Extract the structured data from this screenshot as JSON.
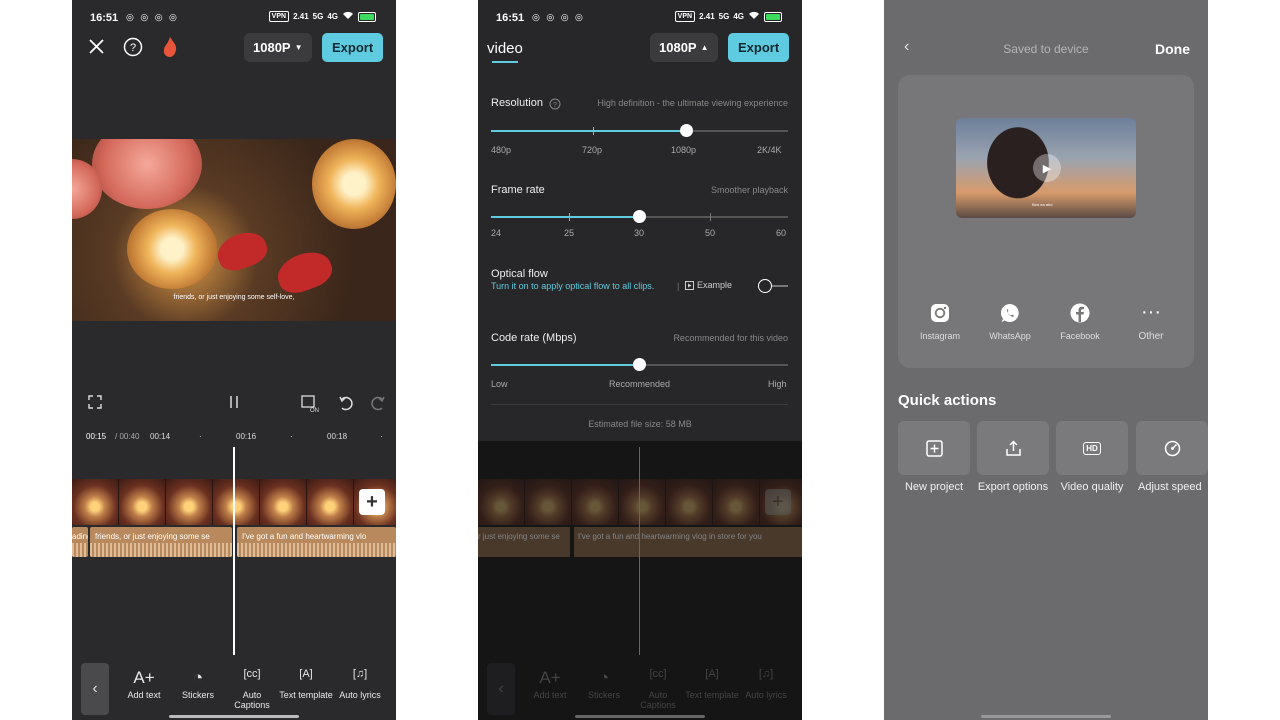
{
  "status": {
    "time": "16:51",
    "notif_icons": "◎ ◎ ◎ ◎",
    "vpn": "VPN",
    "net1": "2.41",
    "net2": "5G",
    "net3": "4G"
  },
  "editor": {
    "resolution_btn": "1080P",
    "export_label": "Export",
    "caption": "friends, or just enjoying some self-love,",
    "timecode_current": "00:15",
    "timecode_total": "/ 00:40",
    "ruler_marks": [
      "00:14",
      "00:16",
      "00:18"
    ],
    "tracks": {
      "left": "ading",
      "middle": "friends, or just enjoying some se",
      "right": "I've got a fun and heartwarming vlo"
    },
    "tools": [
      {
        "label": "Add text",
        "icon": "A+"
      },
      {
        "label": "Stickers",
        "icon": "◔"
      },
      {
        "label": "Auto Captions",
        "icon": "[cc]"
      },
      {
        "label": "Text template",
        "icon": "[A]"
      },
      {
        "label": "Auto lyrics",
        "icon": "[♫]"
      }
    ],
    "add_clip_symbol": "+"
  },
  "export_settings": {
    "tab_title": "video",
    "resolution_btn": "1080P",
    "export_label": "Export",
    "resolution": {
      "label": "Resolution",
      "hint": "High definition - the ultimate viewing experience",
      "options": [
        "480p",
        "720p",
        "1080p",
        "2K/4K"
      ],
      "selected_index": 2
    },
    "frame_rate": {
      "label": "Frame rate",
      "hint": "Smoother playback",
      "options": [
        "24",
        "25",
        "30",
        "50",
        "60"
      ],
      "selected_index": 2
    },
    "optical_flow": {
      "label": "Optical flow",
      "description": "Turn it on to apply optical flow to all clips.",
      "example_label": "Example",
      "enabled": false
    },
    "code_rate": {
      "label": "Code rate (Mbps)",
      "hint": "Recommended for this video",
      "options": [
        "Low",
        "Recommended",
        "High"
      ],
      "selected_index": 1
    },
    "file_size": "Estimated file size: 58 MB",
    "dim_tracks": {
      "left": "r just enjoying some se",
      "right": "I've got a fun and heartwarming vlog in store for you"
    }
  },
  "saved": {
    "back_symbol": "‹",
    "title": "Saved to device",
    "done_label": "Done",
    "thumb_caption": "flow ea ahd",
    "share_targets": [
      {
        "label": "Instagram",
        "icon": "instagram-icon"
      },
      {
        "label": "WhatsApp",
        "icon": "whatsapp-icon"
      },
      {
        "label": "Facebook",
        "icon": "facebook-icon"
      },
      {
        "label": "Other",
        "icon": "more-icon"
      }
    ],
    "quick_actions_title": "Quick actions",
    "quick_actions": [
      {
        "label": "New project",
        "icon": "plus-square-icon"
      },
      {
        "label": "Export options",
        "icon": "upload-icon"
      },
      {
        "label": "Video quality",
        "icon": "hd-icon"
      },
      {
        "label": "Adjust speed",
        "icon": "speed-icon"
      }
    ]
  },
  "colors": {
    "accent": "#5fcbe0",
    "editor_bg": "#2a2a2c",
    "saved_bg": "#6b6b6d"
  }
}
